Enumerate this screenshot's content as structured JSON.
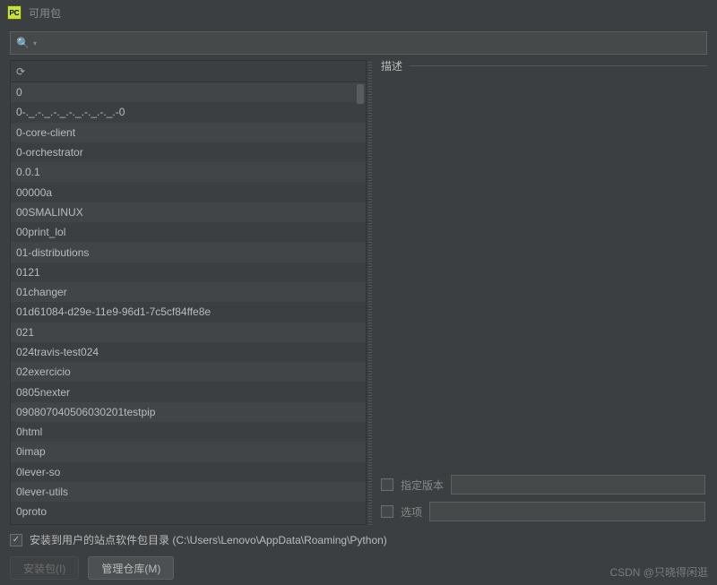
{
  "window": {
    "title": "可用包"
  },
  "search": {
    "placeholder": ""
  },
  "packages": [
    "0",
    "0-._.-._.-._.-._.-._.-._.-0",
    "0-core-client",
    "0-orchestrator",
    "0.0.1",
    "00000a",
    "00SMALINUX",
    "00print_lol",
    "01-distributions",
    "0121",
    "01changer",
    "01d61084-d29e-11e9-96d1-7c5cf84ffe8e",
    "021",
    "024travis-test024",
    "02exercicio",
    "0805nexter",
    "090807040506030201testpip",
    "0html",
    "0imap",
    "0lever-so",
    "0lever-utils",
    "0proto"
  ],
  "right": {
    "description_label": "描述",
    "specify_version_label": "指定版本",
    "options_label": "选项"
  },
  "footer": {
    "install_to_user_label": "安装到用户的站点软件包目录 (C:\\Users\\Lenovo\\AppData\\Roaming\\Python)",
    "install_btn": "安装包(I)",
    "manage_repo_btn": "管理仓库(M)"
  },
  "watermark": "CSDN @只晓得闲逛"
}
